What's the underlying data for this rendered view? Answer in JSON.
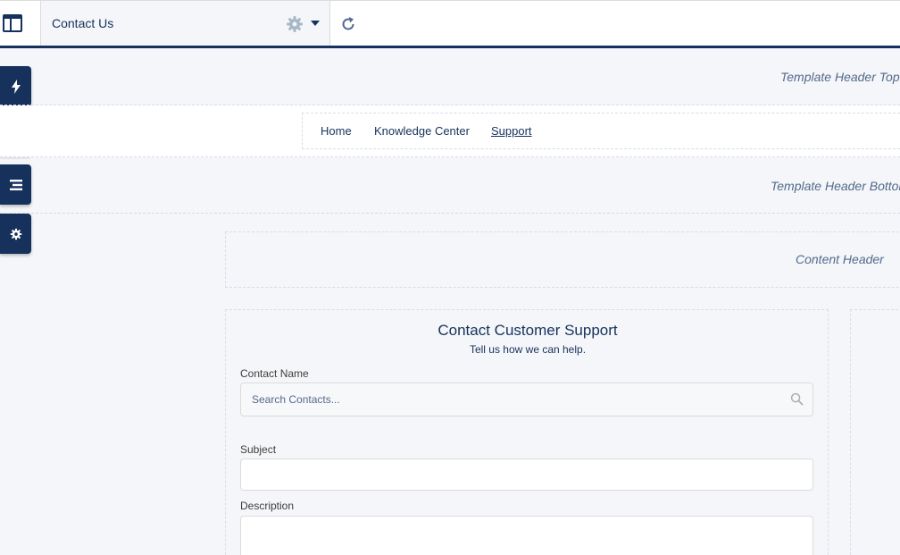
{
  "toolbar": {
    "page_title": "Contact Us",
    "icons": {
      "layout": "layout-icon",
      "settings": "gear-icon",
      "dropdown": "chevron-down-icon",
      "refresh": "refresh-icon"
    }
  },
  "left_rail": {
    "buttons": [
      {
        "icon": "lightning-icon"
      },
      {
        "icon": "brush-icon"
      },
      {
        "icon": "list-icon"
      },
      {
        "icon": "gear-icon"
      }
    ]
  },
  "regions": {
    "header_top": "Template Header Top",
    "header_bottom": "Template Header Bottom",
    "content_header": "Content Header"
  },
  "nav": {
    "items": [
      {
        "label": "Home",
        "active": false
      },
      {
        "label": "Knowledge Center",
        "active": false
      },
      {
        "label": "Support",
        "active": true
      }
    ]
  },
  "form": {
    "title": "Contact Customer Support",
    "subtitle": "Tell us how we can help.",
    "contact_name": {
      "label": "Contact Name",
      "placeholder": "Search Contacts...",
      "value": ""
    },
    "subject": {
      "label": "Subject",
      "value": ""
    },
    "description": {
      "label": "Description",
      "value": ""
    }
  },
  "colors": {
    "brand_navy": "#16325c",
    "background": "#f4f6f9",
    "region_label": "#54698d",
    "border": "#dddbda"
  }
}
